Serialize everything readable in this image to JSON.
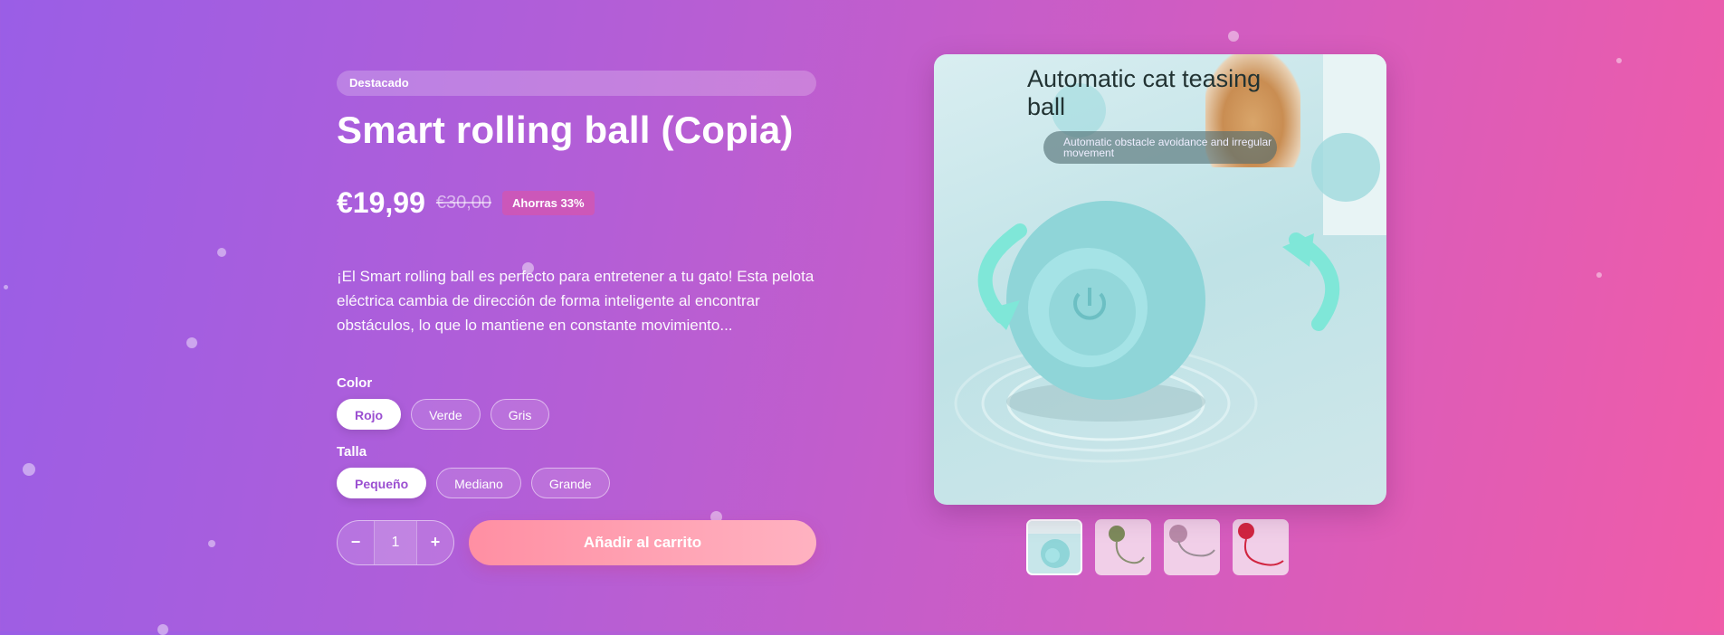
{
  "product": {
    "badge": "Destacado",
    "title": "Smart rolling ball (Copia)",
    "price": "€19,99",
    "old_price": "€30,00",
    "savings": "Ahorras 33%",
    "description": "¡El Smart rolling ball es perfecto para entretener a tu gato! Esta pelota eléctrica cambia de dirección de forma inteligente al encontrar obstáculos, lo que lo mantiene en constante movimiento...",
    "options": [
      {
        "label": "Color",
        "values": [
          "Rojo",
          "Verde",
          "Gris"
        ],
        "selected": "Rojo"
      },
      {
        "label": "Talla",
        "values": [
          "Pequeño",
          "Mediano",
          "Grande"
        ],
        "selected": "Pequeño"
      }
    ],
    "quantity": "1",
    "qty_minus": "−",
    "qty_plus": "+",
    "add_to_cart": "Añadir al carrito"
  },
  "gallery": {
    "image_title": "Automatic cat teasing ball",
    "image_subtitle": "Automatic obstacle avoidance and irregular movement",
    "thumbnail_count": 4,
    "selected_thumbnail": 0
  },
  "colors": {
    "accent": "#9b4fd1",
    "cart_button": "#ff8fa3",
    "ball": "#8fd5d8"
  }
}
